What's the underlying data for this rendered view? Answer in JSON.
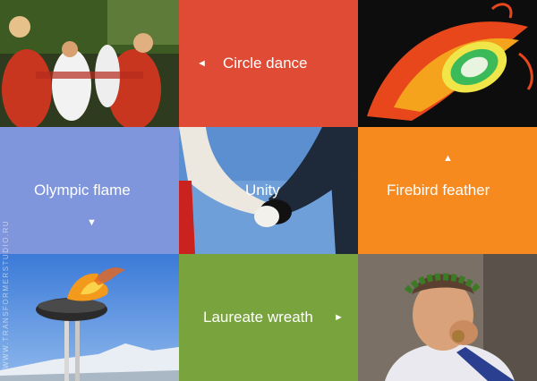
{
  "colors": {
    "circle_dance_tile": "#e04b35",
    "olympic_flame_tile": "#7f96dc",
    "firebird_tile": "#f68a1e",
    "laureate_tile": "#79a33d"
  },
  "tiles": {
    "circle_dance": {
      "label": "Circle dance",
      "arrow_icon": "triangle-left-icon",
      "arrow": "◄"
    },
    "olympic_flame": {
      "label": "Olympic flame",
      "arrow_icon": "triangle-down-icon",
      "arrow": "▼"
    },
    "unity": {
      "label": "Unity"
    },
    "firebird_feather": {
      "label": "Firebird feather",
      "arrow_icon": "triangle-up-icon",
      "arrow": "▲"
    },
    "laureate_wreath": {
      "label": "Laureate wreath",
      "arrow_icon": "triangle-right-icon",
      "arrow": "►"
    }
  },
  "watermark": "WWW.TRANSFORMERSTUDIO.RU"
}
